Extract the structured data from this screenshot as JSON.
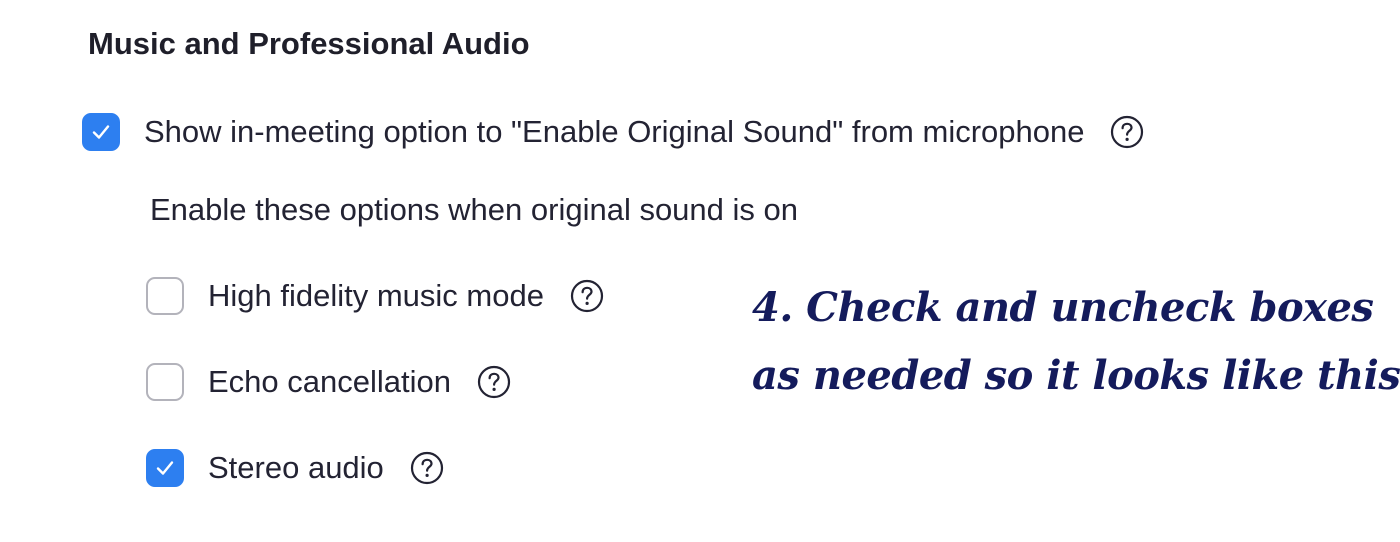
{
  "section": {
    "title": "Music and Professional Audio"
  },
  "original_sound": {
    "label": "Show in-meeting option to \"Enable Original Sound\" from microphone",
    "checked": true,
    "help_icon": "question-circle-icon"
  },
  "sub_options": {
    "heading": "Enable these options when original sound is on",
    "items": [
      {
        "label": "High fidelity music mode",
        "checked": false,
        "help_icon": "question-circle-icon"
      },
      {
        "label": "Echo cancellation",
        "checked": false,
        "help_icon": "question-circle-icon"
      },
      {
        "label": "Stereo audio",
        "checked": true,
        "help_icon": "question-circle-icon"
      }
    ]
  },
  "annotation": {
    "line1": "4. Check and uncheck boxes",
    "line2": "as needed so it looks like this."
  },
  "colors": {
    "checkbox_checked": "#2d7ff0",
    "checkbox_border": "#b3b3bb",
    "text": "#232333",
    "annotation": "#141b5c"
  }
}
